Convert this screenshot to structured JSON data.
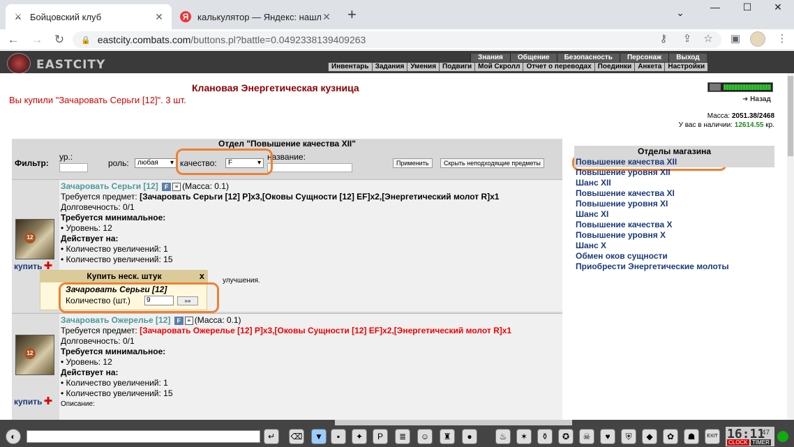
{
  "browser": {
    "tabs": [
      {
        "title": "Бойцовский клуб",
        "icon": "swords-icon"
      },
      {
        "title": "калькулятор — Яндекс: нашлось",
        "icon": "yandex-icon"
      }
    ],
    "url_host": "eastcity.combats.com",
    "url_path": "/buttons.pl?battle=0.0492338139409263"
  },
  "game_header": {
    "logo": "EASTCITY",
    "top_menu": [
      "Знания",
      "Общение",
      "Безопасность",
      "Персонаж",
      "Выход"
    ],
    "sub_menu": [
      "Инвентарь",
      "Задания",
      "Умения",
      "Подвиги",
      "Мой Скролл",
      "Отчет о переводах",
      "Поединки",
      "Анкета",
      "Настройки"
    ]
  },
  "page": {
    "title": "Клановая Энергетическая кузница",
    "message": "Вы купили \"Зачаровать Серьги [12]\". 3 шт.",
    "back_label": "Назад",
    "mass_label": "Масса:",
    "mass_value": "2051.38/2468",
    "money_label": "У вас в наличии:",
    "money_value": "12614.55",
    "money_unit": "кр."
  },
  "section": {
    "title": "Отдел \"Повышение качества XII\"",
    "filter": {
      "label": "Фильтр:",
      "level_label": "ур.:",
      "role_label": "роль:",
      "role_value": "любая",
      "quality_label": "качество:",
      "quality_value": "F",
      "name_label": "название:",
      "apply_label": "Применить",
      "hide_label": "Скрыть неподходящие предметы"
    }
  },
  "items": [
    {
      "name": "Зачаровать Серьги [12]",
      "mass": "(Масса: 0.1)",
      "req_label": "Требуется предмет:",
      "req_value": "[Зачаровать Серьги [12] P]x3,[Оковы Сущности [12] EF]x2,[Энергетический молот R]x1",
      "durability": "Долговечность: 0/1",
      "min_req": "Требуется минимальное:",
      "level": "• Уровень: 12",
      "acts_on": "Действует на:",
      "increase1": "• Количество увеличений: 1",
      "increase2": "• Количество увеличений: 15",
      "desc_tail": "улучшения.",
      "buy": "купить",
      "badge": "12"
    },
    {
      "name": "Зачаровать Ожерелье [12]",
      "mass": "(Масса: 0.1)",
      "req_label": "Требуется предмет:",
      "req_value": "[Зачаровать Ожерелье [12] P]x3,[Оковы Сущности [12] EF]x2,[Энергетический молот R]x1",
      "durability": "Долговечность: 0/1",
      "min_req": "Требуется минимальное:",
      "level": "• Уровень: 12",
      "acts_on": "Действует на:",
      "increase1": "• Количество увеличений: 1",
      "increase2": "• Количество увеличений: 15",
      "desc_label": "Описание:",
      "buy": "купить",
      "badge": "12"
    }
  ],
  "popup": {
    "title": "Купить неск. штук",
    "close": "x",
    "item_name": "Зачаровать Серьги [12]",
    "qty_label": "Количество (шт.)",
    "qty_value": "9",
    "submit": "»»"
  },
  "sidebar": {
    "title": "Отделы магазина",
    "items": [
      "Повышение качества XII",
      "Повышение уровня XII",
      "Шанс XII",
      "Повышение качества XI",
      "Повышение уровня XI",
      "Шанс XI",
      "Повышение качества X",
      "Повышение уровня X",
      "Шанс X",
      "Обмен оков сущности",
      "Приобрести Энергетические молоты"
    ]
  },
  "bottom": {
    "clock": "16:11",
    "seconds": "47",
    "clock_label": "CLOCK",
    "timer_label": "TIMER",
    "exit_label": "EXIT"
  },
  "colors": {
    "highlight": "#f08030",
    "title_red": "#8b0000",
    "link_blue": "#1a3a7a",
    "item_teal": "#4a9a9a",
    "money_green": "#228b22"
  }
}
